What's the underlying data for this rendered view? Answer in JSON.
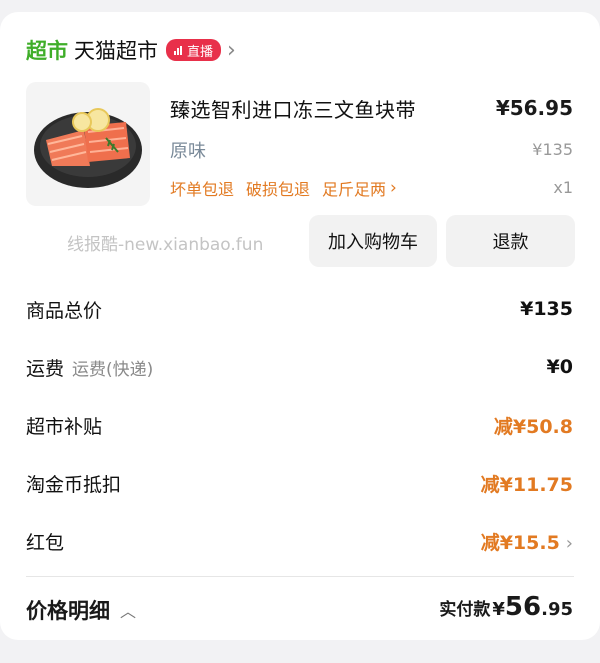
{
  "store": {
    "tag": "超市",
    "name": "天猫超市",
    "live_badge": "直播"
  },
  "product": {
    "title": "臻选智利进口冻三文鱼块带",
    "price": "¥56.95",
    "variant": "原味",
    "original_price": "¥135",
    "guarantees": [
      "坏单包退",
      "破损包退",
      "足斤足两"
    ],
    "quantity": "x1",
    "image_icon": "salmon-fillet-image"
  },
  "watermark": "线报酷-new.xianbao.fun",
  "actions": {
    "add_to_cart": "加入购物车",
    "refund": "退款"
  },
  "summary": [
    {
      "label": "商品总价",
      "sub": "",
      "value": "¥135",
      "discount": false,
      "chevron": false
    },
    {
      "label": "运费",
      "sub": "运费(快递)",
      "value": "¥0",
      "discount": false,
      "chevron": false
    },
    {
      "label": "超市补贴",
      "sub": "",
      "value": "减¥50.8",
      "discount": true,
      "chevron": false
    },
    {
      "label": "淘金币抵扣",
      "sub": "",
      "value": "减¥11.75",
      "discount": true,
      "chevron": false
    },
    {
      "label": "红包",
      "sub": "",
      "value": "减¥15.5",
      "discount": true,
      "chevron": true
    }
  ],
  "footer": {
    "details_label": "价格明细",
    "paid_label": "实付款",
    "paid_symbol": "¥",
    "paid_integer": "56",
    "paid_decimal": ".95"
  },
  "colors": {
    "store_green": "#3fae29",
    "live_red": "#e8304a",
    "discount_orange": "#e27a22"
  }
}
